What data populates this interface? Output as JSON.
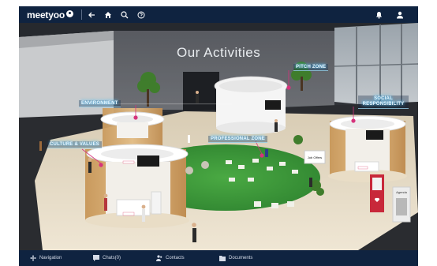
{
  "app": {
    "logo_text": "meetyoo"
  },
  "topbar": {
    "icons": [
      "back-arrow-icon",
      "home-icon",
      "search-icon",
      "help-icon",
      "notification-bell-icon",
      "user-profile-icon"
    ]
  },
  "scene": {
    "hall_title": "Our Activities",
    "booths": [
      {
        "label": "PITCH ZONE"
      },
      {
        "label": "ENVIRONMENT"
      },
      {
        "label": "SOCIAL RESPONSIBILITY"
      },
      {
        "label": "CULTURE & VALUES"
      },
      {
        "label": "PROFESSIONAL ZONE"
      }
    ],
    "panels": {
      "job_offers": "Job Offers",
      "agenda": "Agenda"
    }
  },
  "bottombar": {
    "items": [
      {
        "label": "Navigation",
        "icon": "navigation-icon"
      },
      {
        "label": "Chats(0)",
        "icon": "chat-icon"
      },
      {
        "label": "Contacts",
        "icon": "contacts-icon"
      },
      {
        "label": "Documents",
        "icon": "documents-icon"
      }
    ]
  },
  "colors": {
    "bar": "#0f2340",
    "floor": "#e6dcc8",
    "lawn": "#3d9a3a",
    "wood": "#d7ad72",
    "accent_pink": "#d6337c"
  }
}
